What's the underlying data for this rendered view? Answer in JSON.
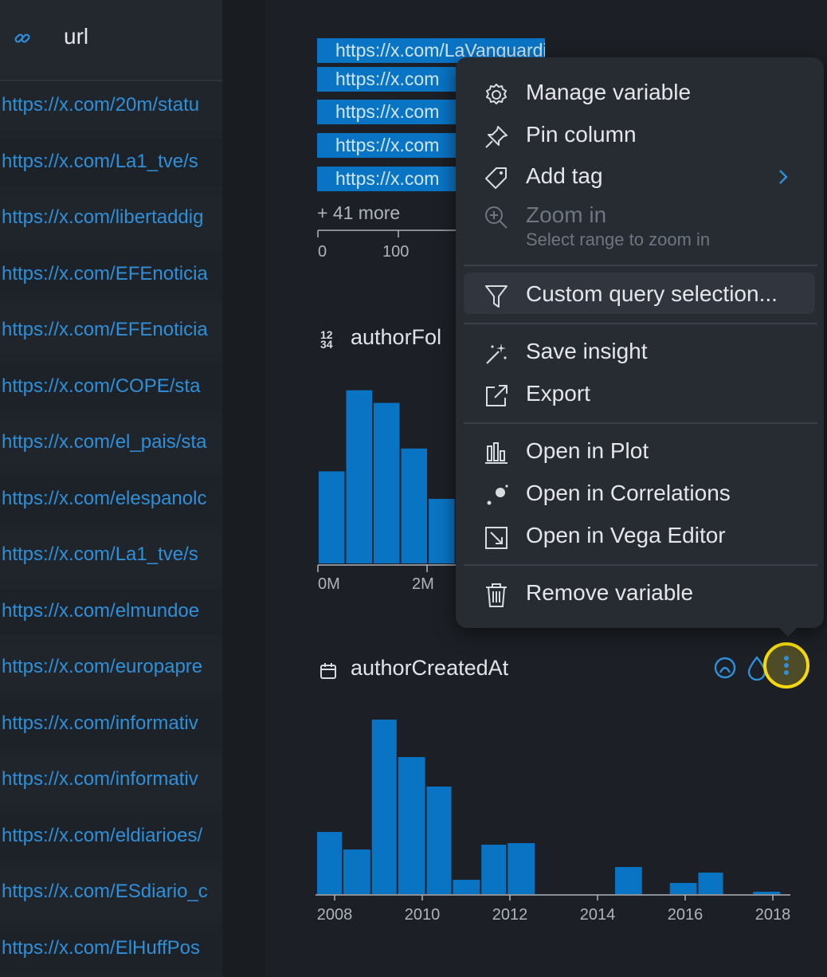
{
  "table": {
    "column_header": "url",
    "rows": [
      "https://x.com/20m/statu",
      "https://x.com/La1_tve/s",
      "https://x.com/libertaddig",
      "https://x.com/EFEnoticia",
      "https://x.com/EFEnoticia",
      "https://x.com/COPE/sta",
      "https://x.com/el_pais/sta",
      "https://x.com/elespanolc",
      "https://x.com/La1_tve/s",
      "https://x.com/elmundoe",
      "https://x.com/europapre",
      "https://x.com/informativ",
      "https://x.com/informativ",
      "https://x.com/eldiarioes/",
      "https://x.com/ESdiario_c",
      "https://x.com/ElHuffPos"
    ]
  },
  "url_variable": {
    "bars": [
      {
        "label": "https://x.com/LaVanguardia",
        "value": 286
      },
      {
        "label": "https://x.com",
        "value": 174
      },
      {
        "label": "https://x.com",
        "value": 174
      },
      {
        "label": "https://x.com",
        "value": 174
      },
      {
        "label": "https://x.com",
        "value": 174
      }
    ],
    "more_label": "+ 41 more",
    "axis_ticks": [
      "0",
      "100"
    ]
  },
  "followers_variable": {
    "title": "authorFol",
    "type_icon_top": "12",
    "type_icon_bottom": "34",
    "axis_ticks": [
      "0M",
      "2M"
    ]
  },
  "created_variable": {
    "title": "authorCreatedAt",
    "calendar_icon": "calendar-icon"
  },
  "context_menu": {
    "items": [
      {
        "label": "Manage variable",
        "icon": "gear-icon"
      },
      {
        "label": "Pin column",
        "icon": "pin-icon"
      },
      {
        "label": "Add tag",
        "icon": "tag-icon"
      },
      {
        "label": "Zoom in",
        "sub": "Select range to zoom in",
        "icon": "zoom-in-icon",
        "disabled": true
      },
      {
        "label": "Custom query selection...",
        "icon": "filter-icon"
      },
      {
        "label": "Save insight",
        "icon": "sparkle-icon"
      },
      {
        "label": "Export",
        "icon": "export-icon"
      },
      {
        "label": "Open in Plot",
        "icon": "bar-chart-icon"
      },
      {
        "label": "Open in Correlations",
        "icon": "scatter-icon"
      },
      {
        "label": "Open in Vega Editor",
        "icon": "vega-editor-icon"
      },
      {
        "label": "Remove variable",
        "icon": "trash-icon"
      }
    ]
  },
  "colors": {
    "accent": "#0a74c4",
    "link": "#2f8fd8",
    "highlight_ring": "#f5d90a",
    "background": "#1c2026"
  },
  "chart_data": [
    {
      "type": "bar",
      "title": "authorFol",
      "xlabel": "",
      "ylabel": "",
      "x_ticks": [
        "0M",
        "2M"
      ],
      "values": [
        117,
        220,
        204,
        146,
        82
      ]
    },
    {
      "type": "bar",
      "title": "authorCreatedAt",
      "xlabel": "",
      "ylabel": "",
      "x_ticks": [
        "2008",
        "2010",
        "2012",
        "2014",
        "2016",
        "2018"
      ],
      "xlim": [
        2007.6,
        2018.25
      ],
      "bins": [
        {
          "start": 2007.6,
          "end": 2008.2,
          "value": 78
        },
        {
          "start": 2008.2,
          "end": 2008.85,
          "value": 56
        },
        {
          "start": 2008.85,
          "end": 2009.45,
          "value": 219
        },
        {
          "start": 2009.45,
          "end": 2010.1,
          "value": 172
        },
        {
          "start": 2010.1,
          "end": 2010.7,
          "value": 135
        },
        {
          "start": 2010.7,
          "end": 2011.35,
          "value": 18
        },
        {
          "start": 2011.35,
          "end": 2011.95,
          "value": 62
        },
        {
          "start": 2011.95,
          "end": 2012.6,
          "value": 64
        },
        {
          "start": 2014.4,
          "end": 2015.05,
          "value": 34
        },
        {
          "start": 2015.65,
          "end": 2016.3,
          "value": 14
        },
        {
          "start": 2016.3,
          "end": 2016.9,
          "value": 27
        },
        {
          "start": 2017.55,
          "end": 2018.2,
          "value": 3
        }
      ]
    }
  ]
}
